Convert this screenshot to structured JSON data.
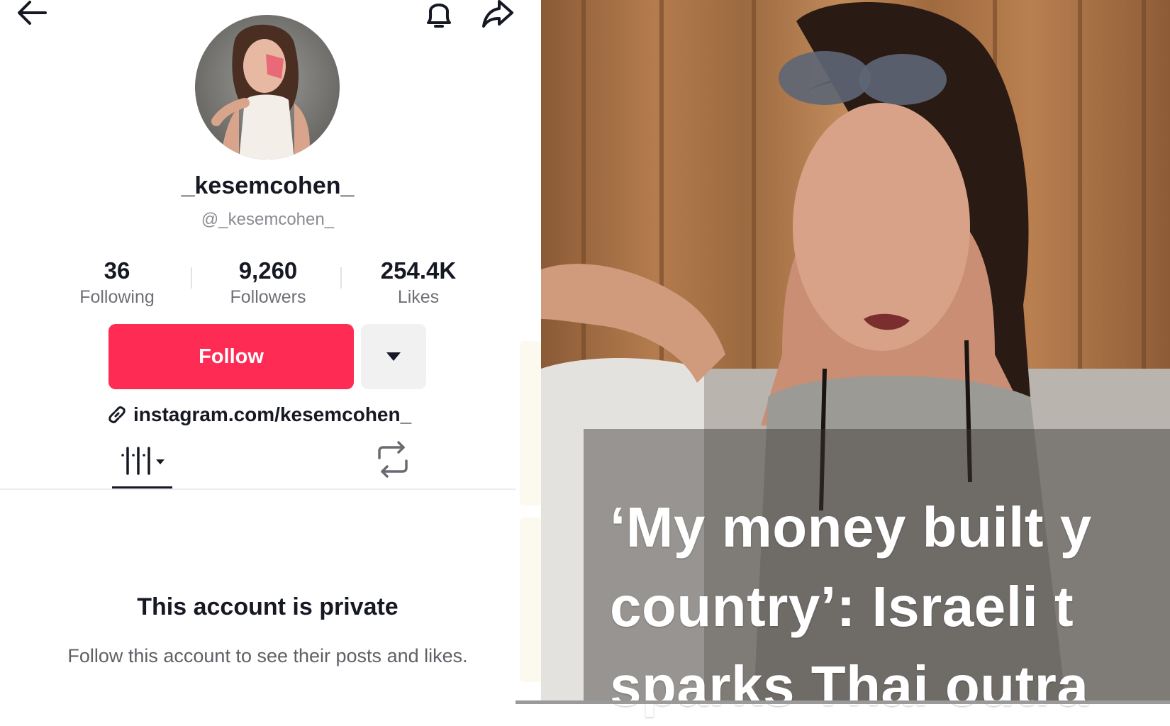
{
  "profile": {
    "display_name": "_kesemcohen_",
    "handle": "@_kesemcohen_",
    "stats": [
      {
        "value": "36",
        "label": "Following"
      },
      {
        "value": "9,260",
        "label": "Followers"
      },
      {
        "value": "254.4K",
        "label": "Likes"
      }
    ],
    "follow_label": "Follow",
    "bio_link": "instagram.com/kesemcohen_",
    "private_title": "This account is private",
    "private_subtitle": "Follow this account to see their posts and likes."
  },
  "video": {
    "headline": "‘My money built y\ncountry’: Israeli t\nsparks Thai outra"
  },
  "icons": {
    "back": "back-arrow-icon",
    "bell": "bell-icon",
    "share": "share-arrow-icon",
    "more": "caret-down-icon",
    "link": "link-icon",
    "videos_tab": "grid-icon",
    "reposts_tab": "repost-icon"
  },
  "colors": {
    "accent": "#fe2c55",
    "text_primary": "#161823",
    "text_secondary": "#8a8b91"
  }
}
